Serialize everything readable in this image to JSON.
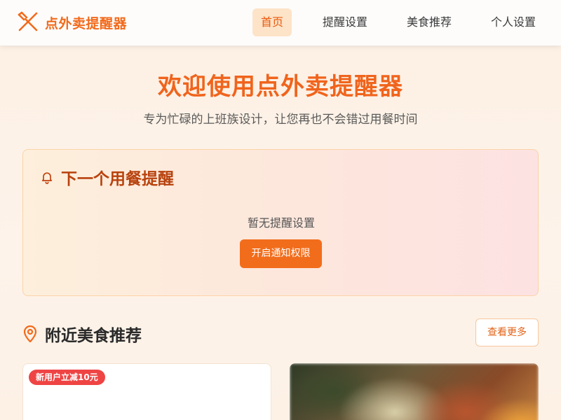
{
  "app": {
    "name": "点外卖提醒器"
  },
  "nav": {
    "home": "首页",
    "reminder_settings": "提醒设置",
    "food_recommend": "美食推荐",
    "profile": "个人设置"
  },
  "hero": {
    "title": "欢迎使用点外卖提醒器",
    "subtitle": "专为忙碌的上班族设计，让您再也不会错过用餐时间"
  },
  "next_reminder": {
    "title": "下一个用餐提醒",
    "empty_text": "暂无提醒设置",
    "button": "开启通知权限"
  },
  "nearby": {
    "title": "附近美食推荐",
    "more_button": "查看更多",
    "cards": [
      {
        "badge": "新用户立减10元"
      },
      {
        "badge": ""
      }
    ]
  },
  "colors": {
    "brand": "#f26a1b",
    "active_nav_bg": "#fde3c8",
    "badge": "#ef4444",
    "reminder_title": "#b8420e"
  },
  "icons": {
    "brand": "fork-knife-icon",
    "reminder": "bell-icon",
    "nearby": "map-pin-icon"
  }
}
